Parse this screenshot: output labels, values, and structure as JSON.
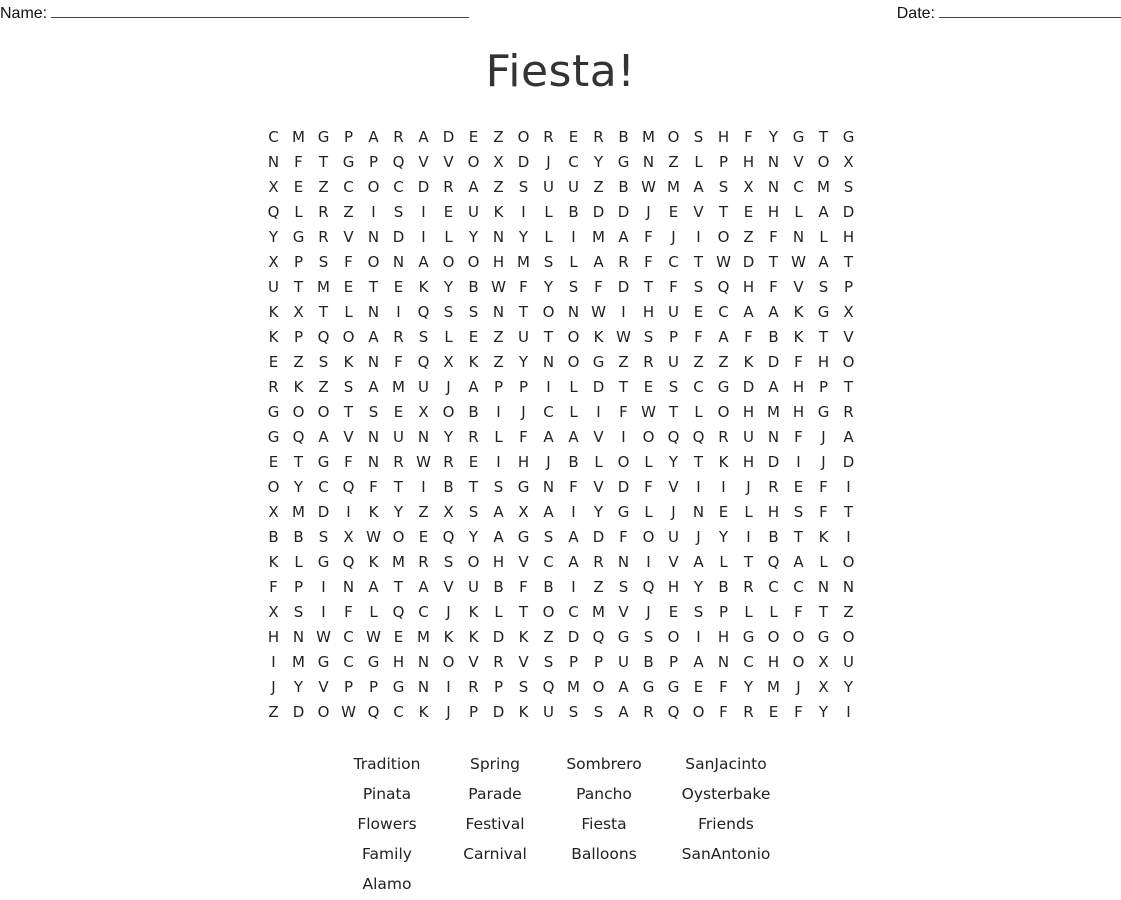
{
  "header": {
    "name_label": "Name:",
    "date_label": "Date:"
  },
  "title": "Fiesta!",
  "grid": [
    "CMGPARADEZORERBMOSHFYGTG",
    "NFTGPQVVOXDJCYGNZLPHNVOX",
    "XEZCOCDRAZSUUZBWMASXNCMS",
    "QLRZISIEUKILBDDJEVTEHLAD",
    "YGRVNDILYNYLIMAFJIOZFNLH",
    "XPSFONAOOHMSLARFCTWDTWAT",
    "UTMETEKYBWFYSFDTFSQHFVSP",
    "KXTLNIQSSNTONWIHUECAAKGX",
    "KPQOARSLEZUTOKWSPFAFBKTV",
    "EZSKNFQXKZYNOGZRUZZKDFHO",
    "RKZSAMUJAPPILDTESCGDAHPT",
    "GOOTSEXOBIJCLIFWTLOHMHGR",
    "GQAVNUNYRLFAAVIOQQRUNFJA",
    "ETGFNRWREIHJBLOLYTKHDIJD",
    "OYCQFTIBTSGNFVDFVIIJREFI",
    "XMDIKYZXSAXAIYGLJNELHSFT",
    "BBSXWOEQYAGSADFOUJYIBTKI",
    "KLGQKMRSOHVCARNIVALTQALO",
    "FPINATAVUBFBIZSQHYBRCCNN",
    "XSIFLQCJKLTOCMVJESPLLFTZ",
    "HNWCWEMKKDKZDQGSOIHGOOGO",
    "IMGCGHNOVRVSPPUBPANCHOXU",
    "JYVPPGNIRPSQMOAGGEFYMJXY",
    "ZDOWQCKJPDKUSSARQOFREFYI"
  ],
  "word_list": [
    "Tradition",
    "Spring",
    "Sombrero",
    "SanJacinto",
    "Pinata",
    "Parade",
    "Pancho",
    "Oysterbake",
    "Flowers",
    "Festival",
    "Fiesta",
    "Friends",
    "Family",
    "Carnival",
    "Balloons",
    "SanAntonio",
    "Alamo"
  ]
}
